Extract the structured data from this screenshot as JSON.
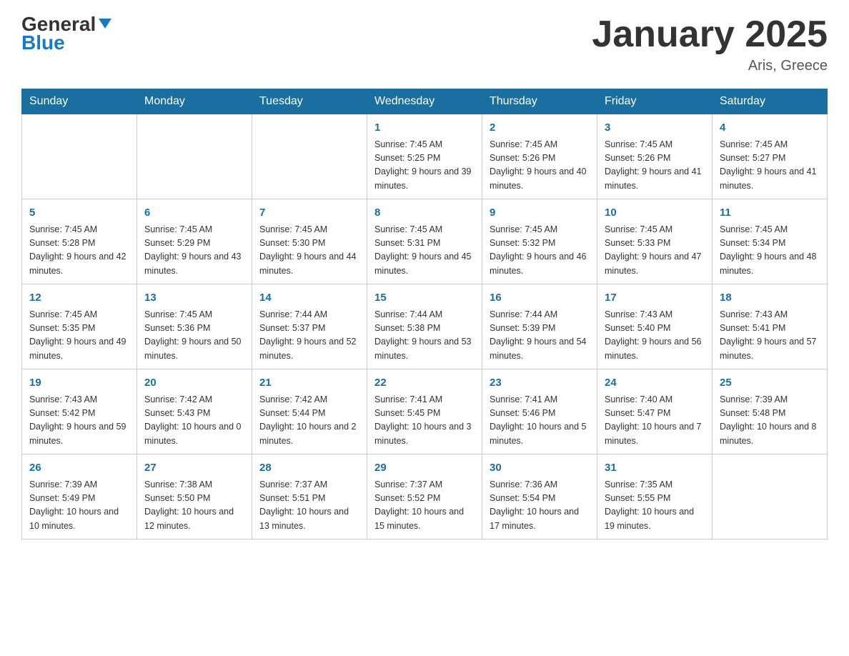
{
  "header": {
    "logo_line1": "General",
    "logo_line2": "Blue",
    "month_title": "January 2025",
    "location": "Aris, Greece"
  },
  "days_of_week": [
    "Sunday",
    "Monday",
    "Tuesday",
    "Wednesday",
    "Thursday",
    "Friday",
    "Saturday"
  ],
  "weeks": [
    [
      {
        "day": "",
        "info": ""
      },
      {
        "day": "",
        "info": ""
      },
      {
        "day": "",
        "info": ""
      },
      {
        "day": "1",
        "info": "Sunrise: 7:45 AM\nSunset: 5:25 PM\nDaylight: 9 hours and 39 minutes."
      },
      {
        "day": "2",
        "info": "Sunrise: 7:45 AM\nSunset: 5:26 PM\nDaylight: 9 hours and 40 minutes."
      },
      {
        "day": "3",
        "info": "Sunrise: 7:45 AM\nSunset: 5:26 PM\nDaylight: 9 hours and 41 minutes."
      },
      {
        "day": "4",
        "info": "Sunrise: 7:45 AM\nSunset: 5:27 PM\nDaylight: 9 hours and 41 minutes."
      }
    ],
    [
      {
        "day": "5",
        "info": "Sunrise: 7:45 AM\nSunset: 5:28 PM\nDaylight: 9 hours and 42 minutes."
      },
      {
        "day": "6",
        "info": "Sunrise: 7:45 AM\nSunset: 5:29 PM\nDaylight: 9 hours and 43 minutes."
      },
      {
        "day": "7",
        "info": "Sunrise: 7:45 AM\nSunset: 5:30 PM\nDaylight: 9 hours and 44 minutes."
      },
      {
        "day": "8",
        "info": "Sunrise: 7:45 AM\nSunset: 5:31 PM\nDaylight: 9 hours and 45 minutes."
      },
      {
        "day": "9",
        "info": "Sunrise: 7:45 AM\nSunset: 5:32 PM\nDaylight: 9 hours and 46 minutes."
      },
      {
        "day": "10",
        "info": "Sunrise: 7:45 AM\nSunset: 5:33 PM\nDaylight: 9 hours and 47 minutes."
      },
      {
        "day": "11",
        "info": "Sunrise: 7:45 AM\nSunset: 5:34 PM\nDaylight: 9 hours and 48 minutes."
      }
    ],
    [
      {
        "day": "12",
        "info": "Sunrise: 7:45 AM\nSunset: 5:35 PM\nDaylight: 9 hours and 49 minutes."
      },
      {
        "day": "13",
        "info": "Sunrise: 7:45 AM\nSunset: 5:36 PM\nDaylight: 9 hours and 50 minutes."
      },
      {
        "day": "14",
        "info": "Sunrise: 7:44 AM\nSunset: 5:37 PM\nDaylight: 9 hours and 52 minutes."
      },
      {
        "day": "15",
        "info": "Sunrise: 7:44 AM\nSunset: 5:38 PM\nDaylight: 9 hours and 53 minutes."
      },
      {
        "day": "16",
        "info": "Sunrise: 7:44 AM\nSunset: 5:39 PM\nDaylight: 9 hours and 54 minutes."
      },
      {
        "day": "17",
        "info": "Sunrise: 7:43 AM\nSunset: 5:40 PM\nDaylight: 9 hours and 56 minutes."
      },
      {
        "day": "18",
        "info": "Sunrise: 7:43 AM\nSunset: 5:41 PM\nDaylight: 9 hours and 57 minutes."
      }
    ],
    [
      {
        "day": "19",
        "info": "Sunrise: 7:43 AM\nSunset: 5:42 PM\nDaylight: 9 hours and 59 minutes."
      },
      {
        "day": "20",
        "info": "Sunrise: 7:42 AM\nSunset: 5:43 PM\nDaylight: 10 hours and 0 minutes."
      },
      {
        "day": "21",
        "info": "Sunrise: 7:42 AM\nSunset: 5:44 PM\nDaylight: 10 hours and 2 minutes."
      },
      {
        "day": "22",
        "info": "Sunrise: 7:41 AM\nSunset: 5:45 PM\nDaylight: 10 hours and 3 minutes."
      },
      {
        "day": "23",
        "info": "Sunrise: 7:41 AM\nSunset: 5:46 PM\nDaylight: 10 hours and 5 minutes."
      },
      {
        "day": "24",
        "info": "Sunrise: 7:40 AM\nSunset: 5:47 PM\nDaylight: 10 hours and 7 minutes."
      },
      {
        "day": "25",
        "info": "Sunrise: 7:39 AM\nSunset: 5:48 PM\nDaylight: 10 hours and 8 minutes."
      }
    ],
    [
      {
        "day": "26",
        "info": "Sunrise: 7:39 AM\nSunset: 5:49 PM\nDaylight: 10 hours and 10 minutes."
      },
      {
        "day": "27",
        "info": "Sunrise: 7:38 AM\nSunset: 5:50 PM\nDaylight: 10 hours and 12 minutes."
      },
      {
        "day": "28",
        "info": "Sunrise: 7:37 AM\nSunset: 5:51 PM\nDaylight: 10 hours and 13 minutes."
      },
      {
        "day": "29",
        "info": "Sunrise: 7:37 AM\nSunset: 5:52 PM\nDaylight: 10 hours and 15 minutes."
      },
      {
        "day": "30",
        "info": "Sunrise: 7:36 AM\nSunset: 5:54 PM\nDaylight: 10 hours and 17 minutes."
      },
      {
        "day": "31",
        "info": "Sunrise: 7:35 AM\nSunset: 5:55 PM\nDaylight: 10 hours and 19 minutes."
      },
      {
        "day": "",
        "info": ""
      }
    ]
  ]
}
